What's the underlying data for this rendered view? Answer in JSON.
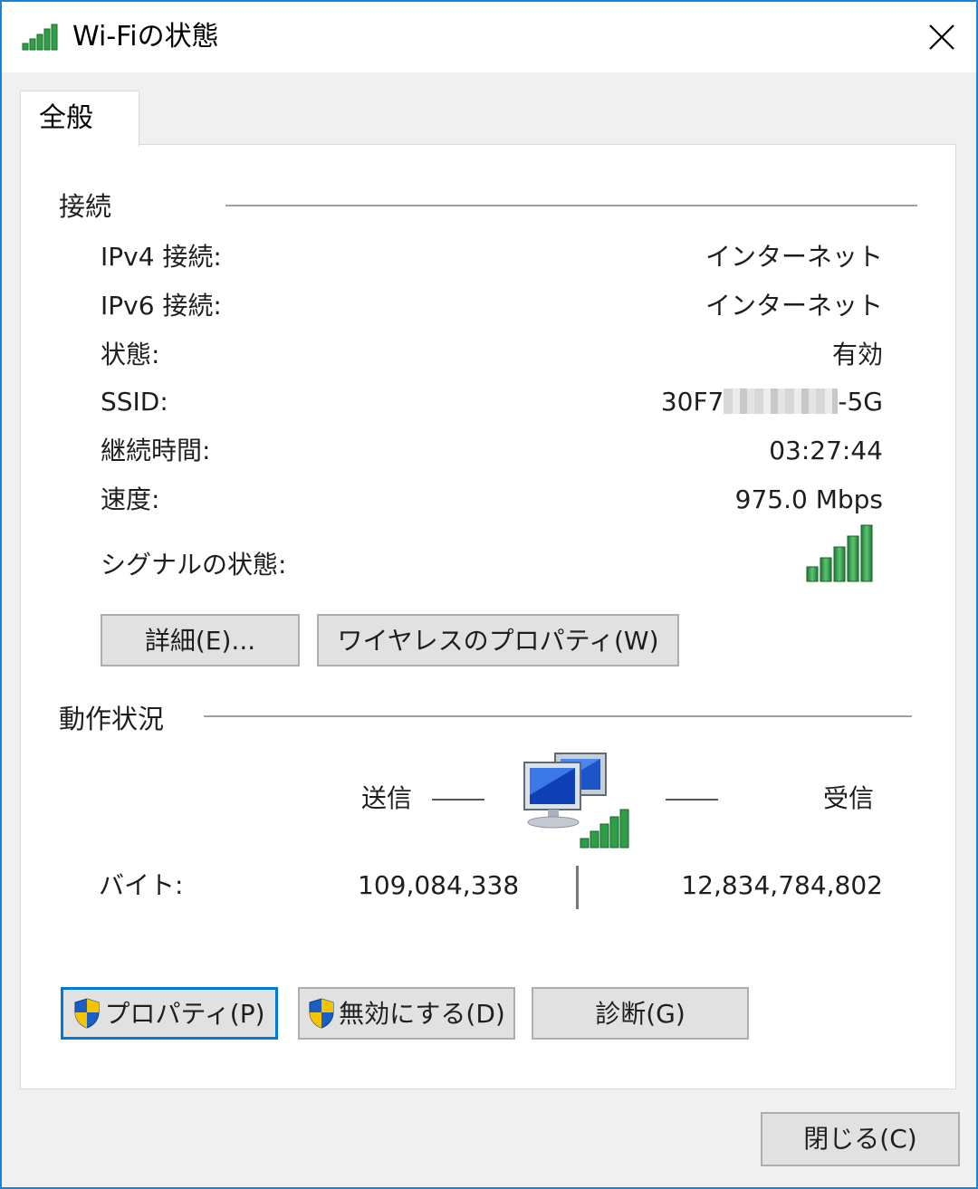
{
  "window": {
    "title": "Wi-Fiの状態",
    "close_glyph": "✕"
  },
  "tabs": [
    {
      "label": "全般"
    }
  ],
  "connection": {
    "section_label": "接続",
    "rows": [
      {
        "label": "IPv4 接続:",
        "value": "インターネット"
      },
      {
        "label": "IPv6 接続:",
        "value": "インターネット"
      },
      {
        "label": "状態:",
        "value": "有効"
      },
      {
        "label": "SSID:",
        "value_prefix": "30F7",
        "value_suffix": "-5G"
      },
      {
        "label": "継続時間:",
        "value": "03:27:44"
      },
      {
        "label": "速度:",
        "value": "975.0 Mbps"
      }
    ],
    "signal_label": "シグナルの状態:",
    "signal_bars_filled": 5,
    "signal_bars_total": 5,
    "details_button": "詳細(E)...",
    "wireless_properties_button": "ワイヤレスのプロパティ(W)"
  },
  "activity": {
    "section_label": "動作状況",
    "sent_label": "送信",
    "received_label": "受信",
    "bytes_label": "バイト:",
    "bytes_sent": "109,084,338",
    "bytes_received": "12,834,784,802"
  },
  "actions": {
    "properties_button": "プロパティ(P)",
    "disable_button": "無効にする(D)",
    "diagnose_button": "診断(G)"
  },
  "footer": {
    "close_button": "閉じる(C)"
  },
  "colors": {
    "accent": "#0078d7",
    "signal_green": "#2e9e47",
    "window_border": "#1883d7"
  },
  "icons": {
    "title": "wifi-signal-icon",
    "close": "close-icon",
    "signal": "signal-strength-icon",
    "network": "network-computers-icon",
    "shield": "uac-shield-icon"
  }
}
